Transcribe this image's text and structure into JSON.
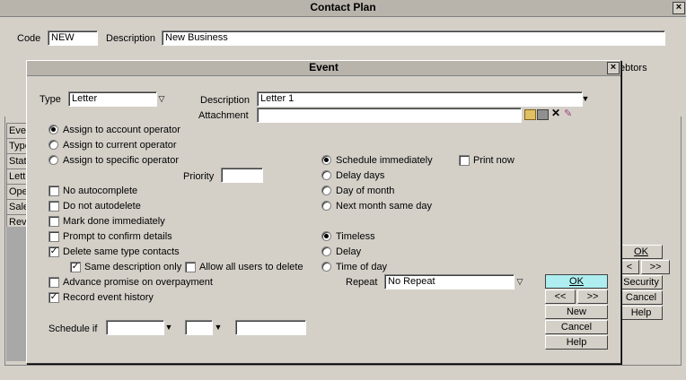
{
  "main_window": {
    "title": "Contact Plan",
    "close": "×",
    "code_label": "Code",
    "code_value": "NEW",
    "description_label": "Description",
    "description_value": "New Business",
    "debtors_label": "ebtors",
    "tabs": [
      "Eve",
      "Type",
      "Stat",
      "Lette",
      "Ope",
      "Sale",
      "Rev"
    ],
    "ok_label": "OK",
    "prev_label": "<",
    "next_label": ">>",
    "security_label": "Security",
    "cancel_label": "Cancel",
    "help_label": "Help"
  },
  "event_dialog": {
    "title": "Event",
    "close": "×",
    "type_label": "Type",
    "type_value": "Letter",
    "description_label": "Description",
    "description_value": "Letter 1",
    "attachment_label": "Attachment",
    "attachment_value": "",
    "assign_account_operator": "Assign to account operator",
    "assign_current_operator": "Assign to current operator",
    "assign_specific_operator": "Assign to specific operator",
    "priority_label": "Priority",
    "priority_value": "",
    "no_autocomplete": "No autocomplete",
    "do_not_autodelete": "Do not autodelete",
    "mark_done_immediately": "Mark done immediately",
    "prompt_confirm_details": "Prompt to confirm details",
    "delete_same_type_contacts": "Delete same type contacts",
    "same_description_only": "Same description only",
    "allow_all_users_delete": "Allow all users to delete",
    "advance_promise_overpayment": "Advance promise on overpayment",
    "record_event_history": "Record event history",
    "schedule_immediately": "Schedule immediately",
    "delay_days": "Delay days",
    "day_of_month": "Day of month",
    "next_month_same_day": "Next month same day",
    "print_now": "Print now",
    "timeless": "Timeless",
    "delay": "Delay",
    "time_of_day": "Time of day",
    "repeat_label": "Repeat",
    "repeat_value": "No Repeat",
    "schedule_if_label": "Schedule if",
    "ok_label": "OK",
    "prev_label": "<<",
    "next_label": ">>",
    "new_label": "New",
    "cancel_label": "Cancel",
    "help_label": "Help"
  }
}
